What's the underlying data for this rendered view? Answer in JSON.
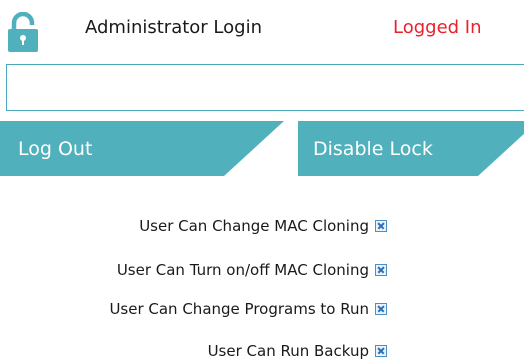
{
  "header": {
    "title": "Administrator Login",
    "status": "Logged In"
  },
  "icons": {
    "lock": "lock-open-icon"
  },
  "password": {
    "value": "",
    "placeholder": ""
  },
  "buttons": {
    "logout": "Log Out",
    "disable_lock": "Disable Lock"
  },
  "permissions": [
    {
      "label": "User Can Change MAC Cloning",
      "checked": true
    },
    {
      "label": "User Can Turn on/off MAC Cloning",
      "checked": true
    },
    {
      "label": "User Can Change Programs to Run",
      "checked": true
    },
    {
      "label": "User Can Run Backup",
      "checked": true
    }
  ],
  "colors": {
    "accent": "#50b0bc",
    "status": "#e8222b",
    "checkbox": "#2f6fb0"
  }
}
